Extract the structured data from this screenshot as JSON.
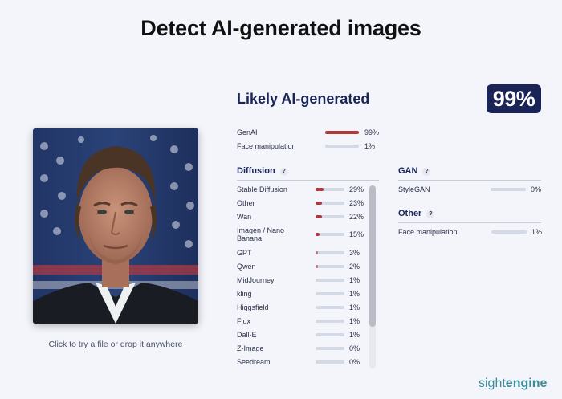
{
  "header": {
    "title": "Detect AI-generated images"
  },
  "upload": {
    "hint": "Click to try a file or drop it anywhere"
  },
  "result": {
    "verdict": "Likely AI-generated",
    "score": "99%"
  },
  "summary": [
    {
      "label": "GenAI",
      "value": 0.99,
      "text": "99%"
    },
    {
      "label": "Face manipulation",
      "value": 0.01,
      "text": "1%"
    }
  ],
  "diffusion": {
    "title": "Diffusion",
    "help": "?",
    "items": [
      {
        "label": "Stable Diffusion",
        "value": 0.29,
        "text": "29%"
      },
      {
        "label": "Other",
        "value": 0.23,
        "text": "23%"
      },
      {
        "label": "Wan",
        "value": 0.22,
        "text": "22%"
      },
      {
        "label": "Imagen / Nano Banana",
        "value": 0.15,
        "text": "15%"
      },
      {
        "label": "GPT",
        "value": 0.03,
        "text": "3%"
      },
      {
        "label": "Qwen",
        "value": 0.02,
        "text": "2%"
      },
      {
        "label": "MidJourney",
        "value": 0.01,
        "text": "1%"
      },
      {
        "label": "kling",
        "value": 0.01,
        "text": "1%"
      },
      {
        "label": "Higgsfield",
        "value": 0.01,
        "text": "1%"
      },
      {
        "label": "Flux",
        "value": 0.01,
        "text": "1%"
      },
      {
        "label": "Dall-E",
        "value": 0.01,
        "text": "1%"
      },
      {
        "label": "Z-Image",
        "value": 0.0,
        "text": "0%"
      },
      {
        "label": "Seedream",
        "value": 0.0,
        "text": "0%"
      }
    ]
  },
  "gan": {
    "title": "GAN",
    "help": "?",
    "items": [
      {
        "label": "StyleGAN",
        "value": 0.0,
        "text": "0%"
      }
    ]
  },
  "other": {
    "title": "Other",
    "help": "?",
    "items": [
      {
        "label": "Face manipulation",
        "value": 0.01,
        "text": "1%"
      }
    ]
  },
  "footer": {
    "brand_light": "sight",
    "brand_bold": "engine"
  },
  "colors": {
    "accent": "#b2373a",
    "navy": "#1a2456",
    "brand": "#3d8e99"
  }
}
